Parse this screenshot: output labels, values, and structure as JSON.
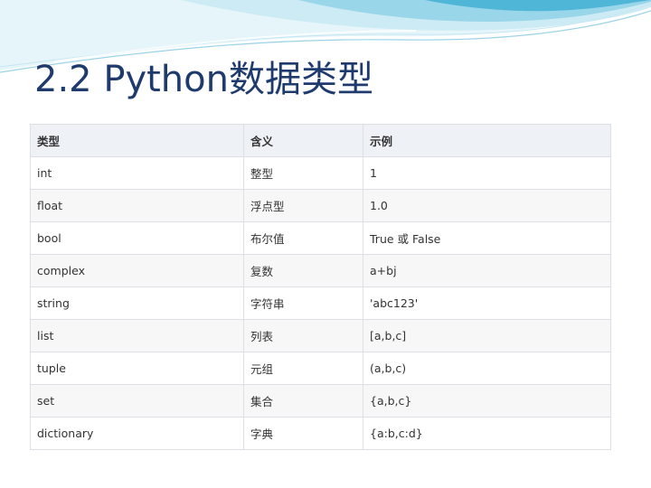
{
  "slide": {
    "title": "2.2  Python数据类型"
  },
  "table": {
    "headers": [
      "类型",
      "含义",
      "示例"
    ],
    "rows": [
      [
        "int",
        "整型",
        "1"
      ],
      [
        "float",
        "浮点型",
        "1.0"
      ],
      [
        "bool",
        "布尔值",
        "True 或 False"
      ],
      [
        "complex",
        "复数",
        "a+bj"
      ],
      [
        "string",
        "字符串",
        "'abc123'"
      ],
      [
        "list",
        "列表",
        "[a,b,c]"
      ],
      [
        "tuple",
        "元组",
        "(a,b,c)"
      ],
      [
        "set",
        "集合",
        "{a,b,c}"
      ],
      [
        "dictionary",
        "字典",
        "{a:b,c:d}"
      ]
    ]
  },
  "colors": {
    "title": "#1f3b6e",
    "header_bg": "#eef1f5",
    "stripe_bg": "#f7f7f7",
    "wave_light": "#bfe6f2",
    "wave_dark": "#4fb6d8"
  }
}
